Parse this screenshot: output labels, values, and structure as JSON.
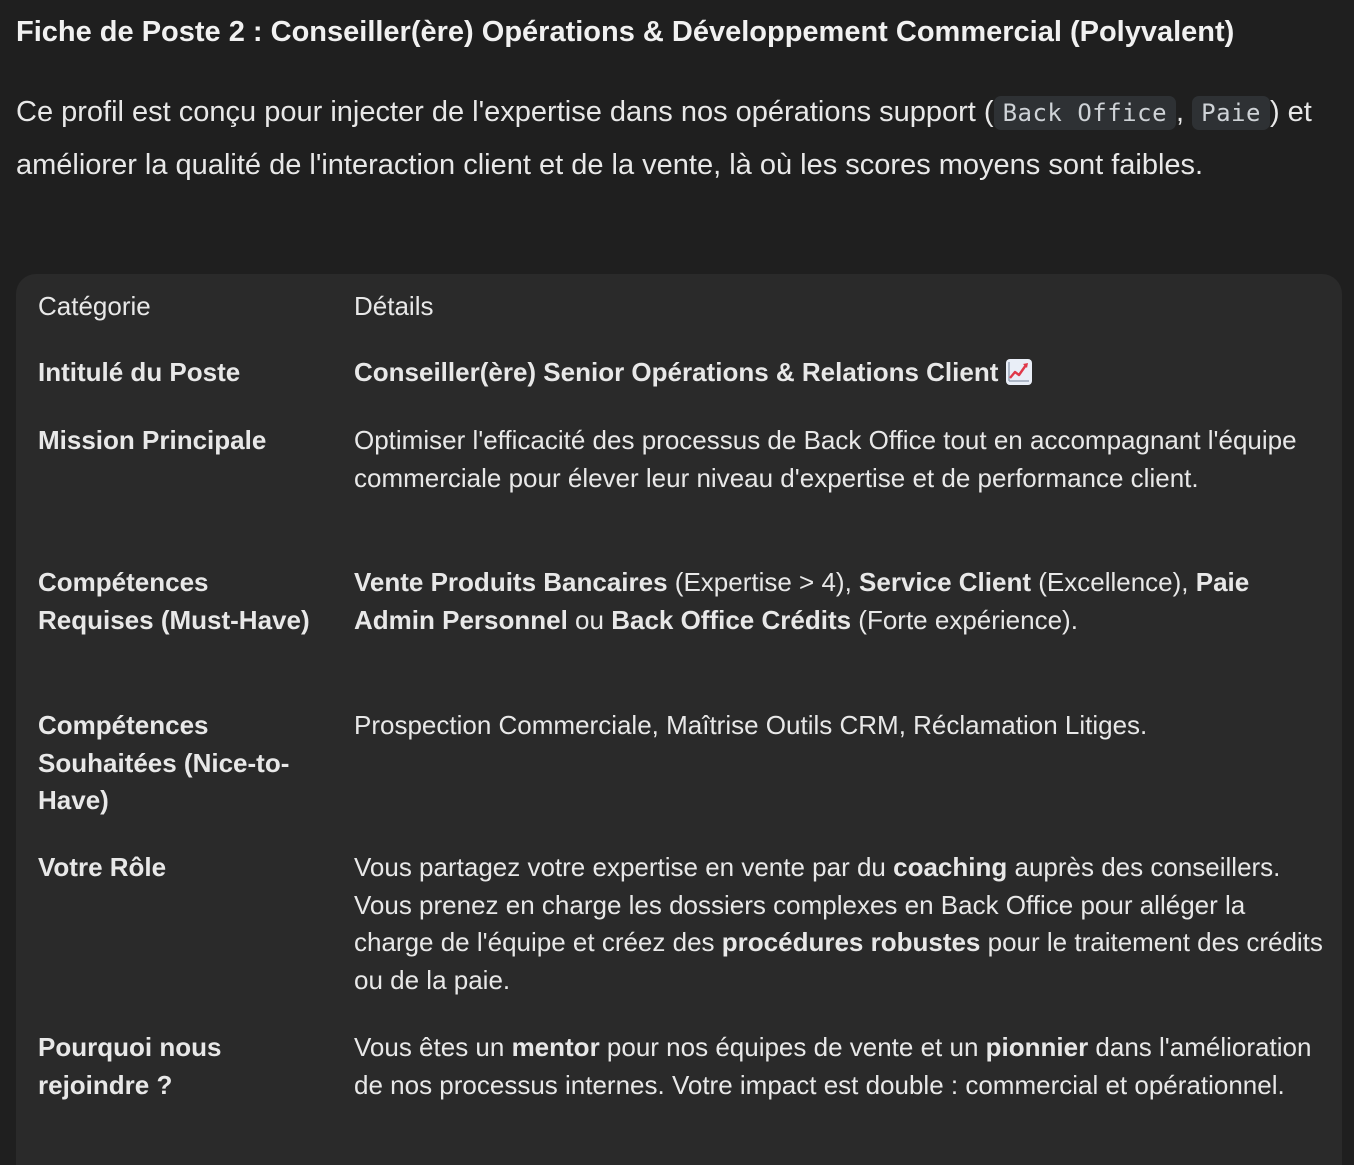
{
  "heading": "Fiche de Poste 2 : Conseiller(ère) Opérations & Développement Commercial (Polyvalent)",
  "intro": {
    "part1": "Ce profil est conçu pour injecter de l'expertise dans nos opérations support (",
    "code1": "Back Office",
    "part2": ", ",
    "code2": "Paie",
    "part3": ") et améliorer la qualité de l'interaction client et de la vente, là où les scores moyens sont faibles."
  },
  "table": {
    "headers": [
      "Catégorie",
      "Détails"
    ],
    "rows": [
      {
        "category": "Intitulé du Poste",
        "details": {
          "b1": "Conseiller(ère) Senior Opérations & Relations Client",
          "icon": "chart-increasing-icon"
        }
      },
      {
        "category": "Mission Principale",
        "details": {
          "t1": "Optimiser l'efficacité des processus de Back Office tout en accompagnant l'équipe commerciale pour élever leur niveau d'expertise et de performance client."
        }
      },
      {
        "category": "Compétences Requises (Must-Have)",
        "details": {
          "b1": "Vente Produits Bancaires",
          "t1": " (Expertise > 4), ",
          "b2": "Service Client",
          "t2": " (Excellence), ",
          "b3": "Paie Admin Personnel",
          "t3": " ou ",
          "b4": "Back Office Crédits",
          "t4": " (Forte expérience)."
        }
      },
      {
        "category": "Compétences Souhaitées (Nice-to-Have)",
        "details": {
          "t1": "Prospection Commerciale, Maîtrise Outils CRM, Réclamation Litiges."
        }
      },
      {
        "category": "Votre Rôle",
        "details": {
          "t1": "Vous partagez votre expertise en vente par du ",
          "b1": "coaching",
          "t2": " auprès des conseillers. Vous prenez en charge les dossiers complexes en Back Office pour alléger la charge de l'équipe et créez des ",
          "b2": "procédures robustes",
          "t3": " pour le traitement des crédits ou de la paie."
        }
      },
      {
        "category": "Pourquoi nous rejoindre ?",
        "details": {
          "t1": "Vous êtes un ",
          "b1": "mentor",
          "t2": " pour nos équipes de vente et un ",
          "b2": "pionnier",
          "t3": " dans l'amélioration de nos processus internes. Votre impact est double : commercial et opérationnel."
        }
      }
    ]
  }
}
